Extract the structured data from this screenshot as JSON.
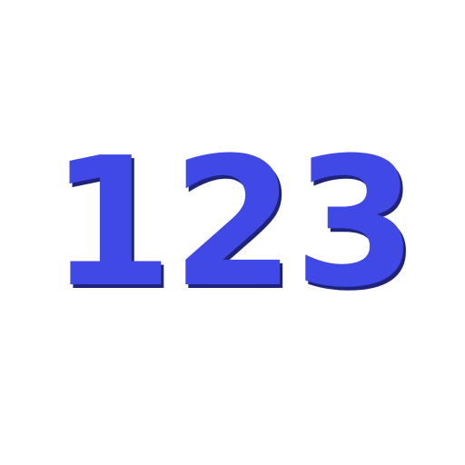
{
  "graphic": {
    "text": "123",
    "fill_color": "#4049e5",
    "edge_color": "#1f247a"
  }
}
